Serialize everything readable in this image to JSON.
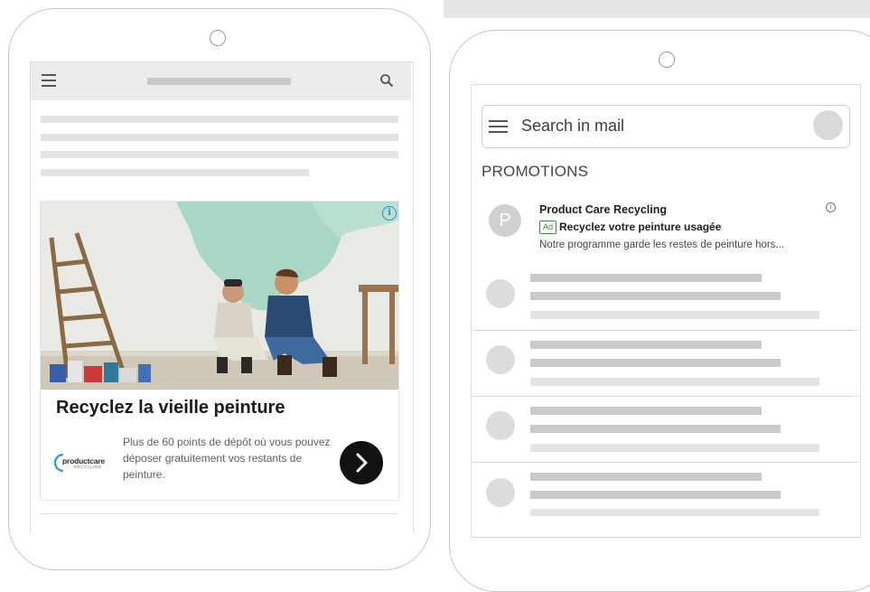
{
  "left_phone": {
    "header": {
      "menu_icon": "hamburger-icon",
      "search_icon": "search-icon"
    },
    "ad": {
      "info_icon": "info-icon",
      "headline": "Recyclez la vieille peinture",
      "logo_text": "productcare",
      "logo_subtext": "RECYCLING",
      "description": "Plus de 60 points de dépôt où vous pouvez déposer gratuitement vos restants de peinture.",
      "cta_icon": "chevron-right-icon"
    }
  },
  "right_phone": {
    "search": {
      "placeholder": "Search in mail",
      "menu_icon": "hamburger-icon"
    },
    "section_label": "PROMOTIONS",
    "promo_email": {
      "avatar_letter": "P",
      "sender": "Product Care Recycling",
      "ad_badge": "Ad",
      "subject": "Recyclez votre peinture usagée",
      "snippet": "Notre programme garde les restes de peinture hors...",
      "info_icon": "info-icon"
    }
  },
  "colors": {
    "accent_blue": "#2c8bd6",
    "ad_green": "#3c8a3c",
    "cta_black": "#121212"
  }
}
